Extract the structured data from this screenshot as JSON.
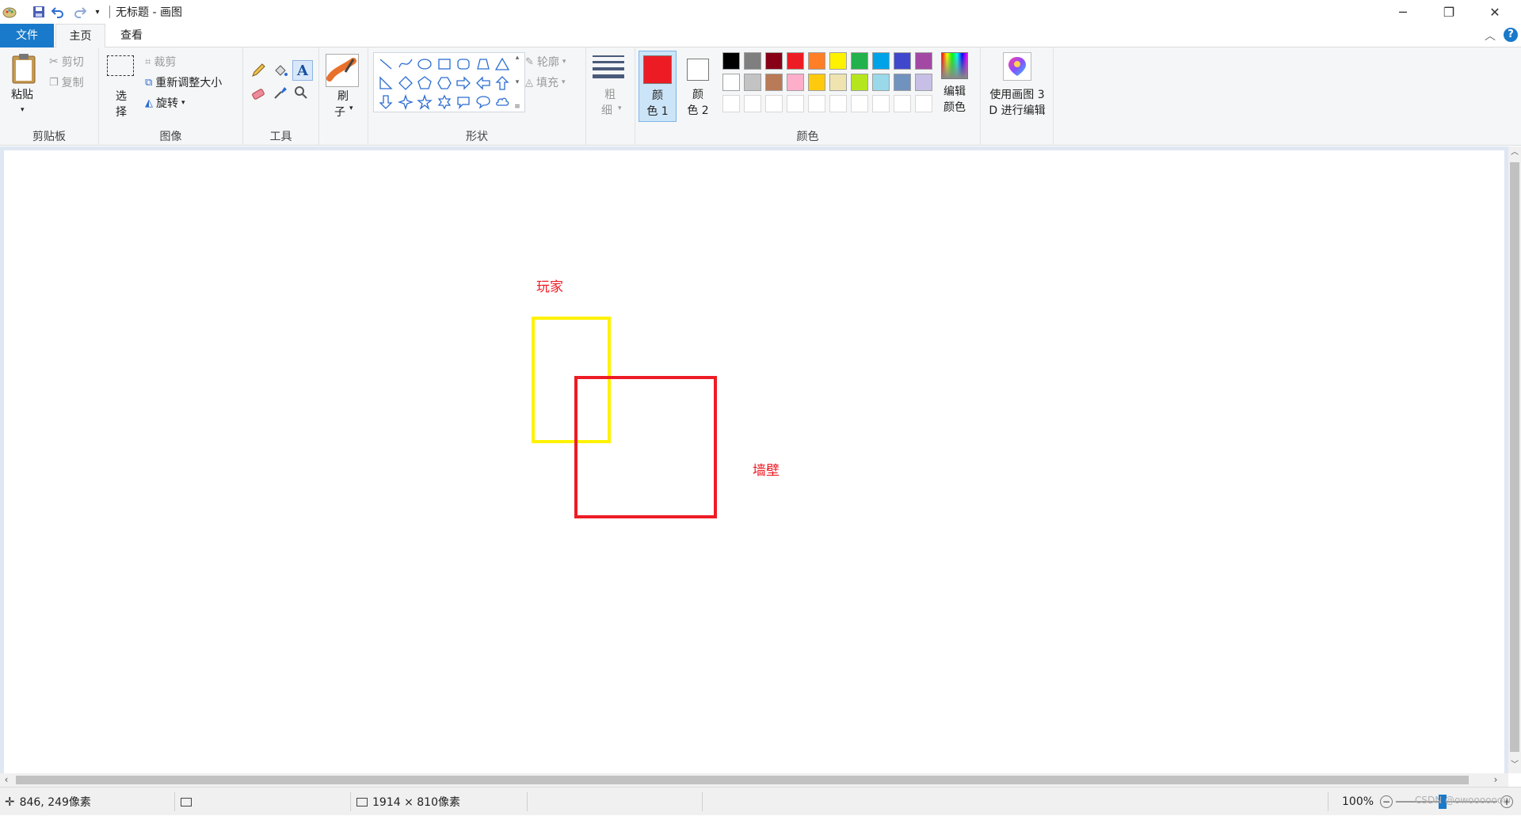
{
  "window": {
    "title": "无标题 - 画图",
    "minimize": "─",
    "maximize": "❐",
    "close": "✕"
  },
  "tabs": {
    "file": "文件",
    "home": "主页",
    "view": "查看"
  },
  "ribbon": {
    "clipboard": {
      "label": "剪贴板",
      "paste": "粘贴",
      "cut": "剪切",
      "copy": "复制"
    },
    "image": {
      "label": "图像",
      "select_1": "选",
      "select_2": "择",
      "crop": "裁剪",
      "resize": "重新调整大小",
      "rotate": "旋转"
    },
    "tools": {
      "label": "工具"
    },
    "brushes": {
      "label_1": "刷",
      "label_2": "子"
    },
    "shapes": {
      "label": "形状",
      "outline": "轮廓",
      "fill": "填充"
    },
    "size": {
      "label_1": "粗",
      "label_2": "细"
    },
    "colors": {
      "label": "颜色",
      "color1_a": "颜",
      "color1_b": "色 1",
      "color2_a": "颜",
      "color2_b": "色 2",
      "edit_a": "编辑",
      "edit_b": "颜色",
      "color1_value": "#ed1c24",
      "color2_value": "#ffffff",
      "row1": [
        "#000000",
        "#7f7f7f",
        "#880015",
        "#ed1c24",
        "#ff7f27",
        "#fff200",
        "#22b14c",
        "#00a2e8",
        "#3f48cc",
        "#a349a4"
      ],
      "row2": [
        "#ffffff",
        "#c3c3c3",
        "#b97a57",
        "#ffaec9",
        "#ffc90e",
        "#efe4b0",
        "#b5e61d",
        "#99d9ea",
        "#7092be",
        "#c8bfe7"
      ]
    },
    "paint3d": {
      "line1": "使用画图 3",
      "line2": "D 进行编辑"
    }
  },
  "canvas": {
    "player_label": "玩家",
    "wall_label": "墙壁",
    "player_color": "#fff200",
    "wall_color": "#ed1c24"
  },
  "status": {
    "cursor_pos": "846, 249像素",
    "canvas_size": "1914 × 810像素",
    "zoom": "100%",
    "watermark": "CSDN @owoooooow"
  }
}
